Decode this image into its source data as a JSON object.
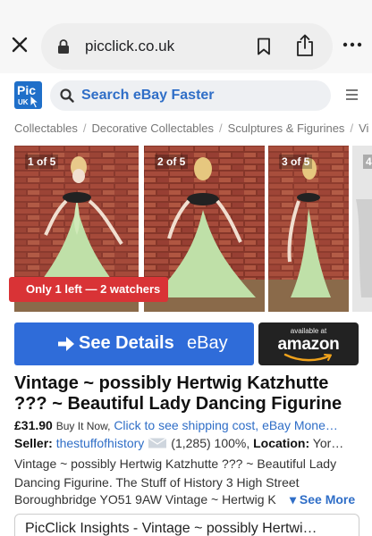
{
  "browser": {
    "url": "picclick.co.uk",
    "icons": [
      "close-icon",
      "lock-icon",
      "bookmark-icon",
      "share-icon",
      "more-icon"
    ]
  },
  "header": {
    "logo_text": "Pic",
    "logo_sub": "UK",
    "search_label": "Search eBay Faster",
    "brand_color": "#1f6fc9"
  },
  "breadcrumbs": [
    "Collectables",
    "Decorative Collectables",
    "Sculptures & Figurines",
    "Vi"
  ],
  "photos": [
    {
      "label": "1 of 5"
    },
    {
      "label": "2 of 5"
    },
    {
      "label": "3 of 5"
    },
    {
      "label": "4"
    }
  ],
  "stock_badge": "Only 1 left — 2 watchers",
  "buttons": {
    "see_details": "See Details",
    "see_details_brand": "eBay",
    "amazon_available": "available at",
    "amazon_name": "amazon"
  },
  "listing": {
    "title": "Vintage ~ possibly Hertwig Katzhutte ??? ~ Beautiful Lady Dancing Figurine",
    "price": "£31.90",
    "buy_type": "Buy It Now,",
    "shipping_link": "Click to see shipping cost,",
    "ebay_more": "eBay Mone…",
    "seller_label": "Seller:",
    "seller_name": "thestuffofhistory",
    "seller_stats": "(1,285) 100%,",
    "location_label": "Location:",
    "location_value": "Yor…",
    "description": "Vintage ~ possibly Hertwig Katzhutte ??? ~ Beautiful Lady Dancing Figurine. The Stuff of History 3 High Street",
    "description_last": "Boroughbridge YO51 9AW Vintage ~ Hertwig K",
    "see_more": "▾ See More"
  },
  "insights": {
    "title": "PicClick Insights - Vintage ~ possibly Hertwi…"
  },
  "colors": {
    "link": "#2f6ec7",
    "ebay_button": "#2f6cd9",
    "badge_red": "#d93336",
    "amazon_bg": "#222222",
    "amazon_smile": "#f0a21b"
  }
}
